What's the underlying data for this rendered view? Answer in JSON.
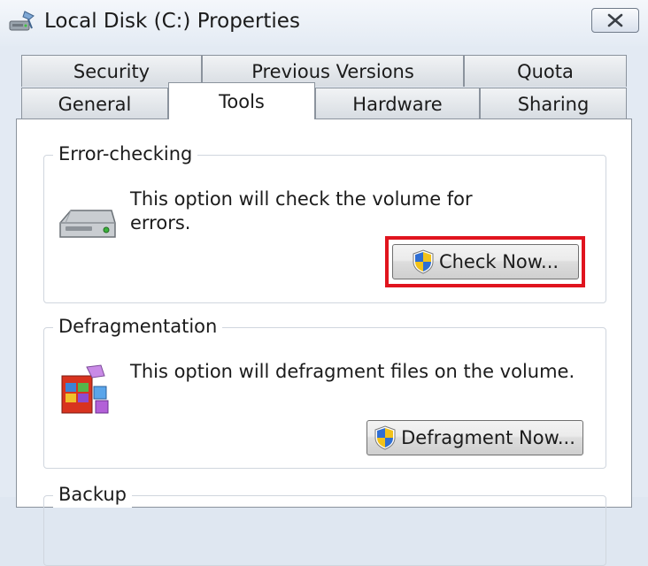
{
  "window": {
    "title": "Local Disk (C:) Properties",
    "icon": "drive-properties-icon",
    "close_icon": "close-icon"
  },
  "tabs": {
    "row1": [
      {
        "label": "Security"
      },
      {
        "label": "Previous Versions"
      },
      {
        "label": "Quota"
      }
    ],
    "row2": [
      {
        "label": "General"
      },
      {
        "label": "Tools",
        "active": true
      },
      {
        "label": "Hardware"
      },
      {
        "label": "Sharing"
      }
    ]
  },
  "error_checking": {
    "title": "Error-checking",
    "description_line1": "This option will check the volume for",
    "description_line2": "errors.",
    "button_label": "Check Now...",
    "icon": "hard-drive-icon",
    "button_icon": "uac-shield-icon",
    "highlight_color": "#e0141e"
  },
  "defragmentation": {
    "title": "Defragmentation",
    "description": "This option will defragment files on the volume.",
    "button_label": "Defragment Now...",
    "icon": "defragmenter-icon",
    "button_icon": "uac-shield-icon"
  },
  "backup": {
    "title": "Backup"
  }
}
